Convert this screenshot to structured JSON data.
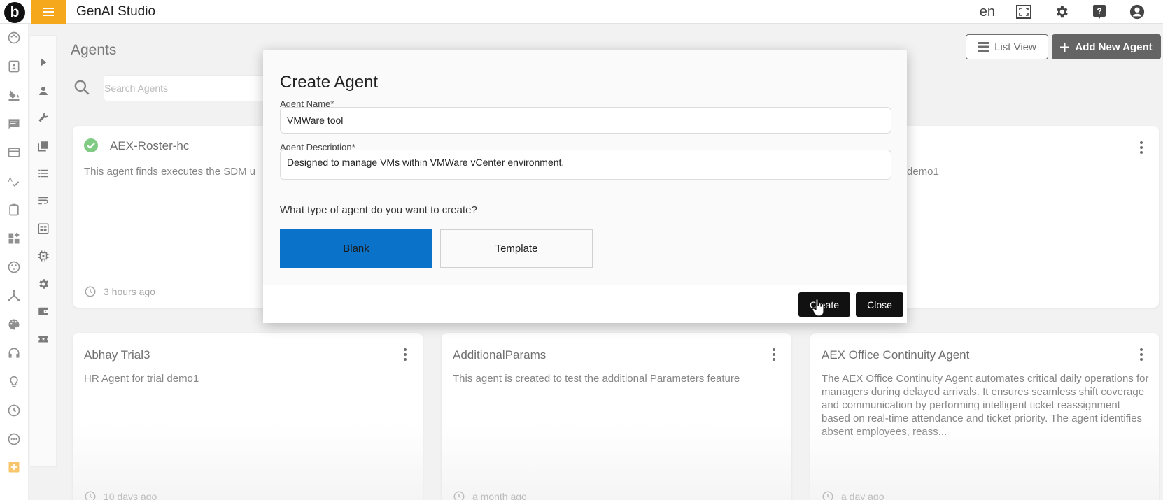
{
  "app": {
    "title": "GenAI Studio",
    "logo_letter": "b"
  },
  "topbar": {
    "language": "en",
    "icons": [
      "fullscreen-icon",
      "settings-gear-icon",
      "help-icon",
      "account-icon"
    ]
  },
  "page": {
    "title": "Agents",
    "search_placeholder": "Search Agents",
    "list_view_label": "List View",
    "add_agent_label": "Add New Agent"
  },
  "cards": [
    {
      "title": "AEX-Roster-hc",
      "description": "This agent finds executes the SDM u",
      "time": "3 hours ago",
      "status": "active"
    },
    {
      "title": "",
      "description": "demo1",
      "time": ""
    },
    {
      "title": "Abhay Trial3",
      "description": "HR Agent for trial demo1",
      "time": "10 days ago"
    },
    {
      "title": "AdditionalParams",
      "description": "This agent is created to test the additional Parameters feature",
      "time": "a month ago"
    },
    {
      "title": "AEX Office Continuity Agent",
      "description": "The AEX Office Continuity Agent automates critical daily operations for managers during delayed arrivals. It ensures seamless shift coverage and communication by performing intelligent ticket reassignment based on real-time attendance and ticket priority. The agent identifies absent employees, reass...",
      "time": "a day ago"
    }
  ],
  "modal": {
    "title": "Create Agent",
    "name_label": "Agent Name*",
    "name_value": "VMWare tool",
    "description_label": "Agent Description*",
    "description_value": "Designed to manage VMs within VMWare vCenter environment.",
    "question": "What type of agent do you want to create?",
    "blank_label": "Blank",
    "template_label": "Template",
    "selected_type": "Blank",
    "create_label": "Create",
    "close_label": "Close"
  },
  "colors": {
    "accent": "#f5a81b",
    "primary_blue": "#0a72c9",
    "dark_button": "#111111",
    "status_green": "#3cb043"
  }
}
